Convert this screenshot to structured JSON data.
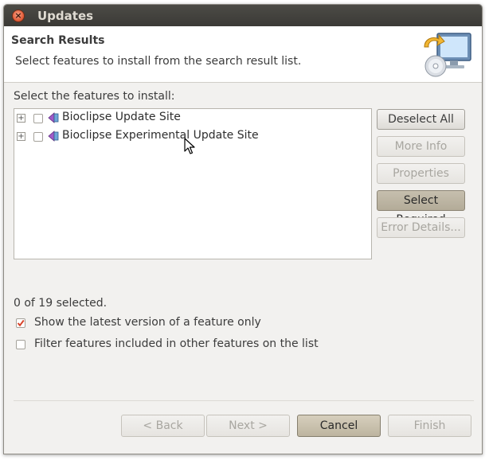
{
  "window": {
    "title": "Updates"
  },
  "header": {
    "title": "Search Results",
    "description": "Select features to install from the search result list."
  },
  "features": {
    "label": "Select the features to install:",
    "items": [
      {
        "label": "Bioclipse Update Site",
        "checked": false
      },
      {
        "label": "Bioclipse Experimental Update Site",
        "checked": false
      }
    ]
  },
  "side_buttons": {
    "deselect_all": "Deselect All",
    "more_info": "More Info",
    "properties": "Properties",
    "select_required": "Select Required",
    "error_details": "Error Details..."
  },
  "status": "0 of 19 selected.",
  "options": {
    "latest_version": {
      "label": "Show the latest version of a feature only",
      "checked": true
    },
    "filter_included": {
      "label": "Filter features included in other features on the list",
      "checked": false
    }
  },
  "nav": {
    "back": "< Back",
    "next": "Next >",
    "cancel": "Cancel",
    "finish": "Finish"
  },
  "colors": {
    "titlebar": "#3b3a36",
    "checkbox_check": "#d8432a",
    "pressed_button": "#b3ab98"
  },
  "icons": {
    "close": "close-icon",
    "header_art": "update-computer-icon",
    "feature": "feature-plugin-icon",
    "expand": "plus-expander-icon"
  }
}
